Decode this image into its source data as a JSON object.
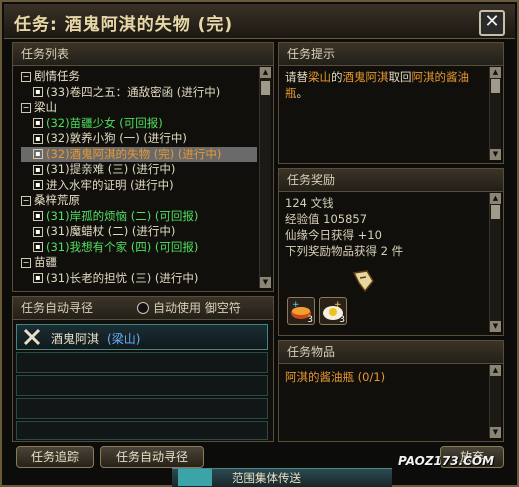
{
  "window": {
    "title": "任务: 酒鬼阿淇的失物 (完)",
    "close_glyph": "✕"
  },
  "quest_list": {
    "header": "任务列表",
    "rows": [
      {
        "label": "剧情任务",
        "type": "cat",
        "box": "−"
      },
      {
        "label": "(33)卷四之五：通敌密函 (进行中)",
        "type": "quest",
        "color": "white",
        "box": "▪"
      },
      {
        "label": "梁山",
        "type": "cat",
        "box": "−"
      },
      {
        "label": "(32)苗疆少女 (可回报)",
        "type": "quest",
        "color": "green",
        "box": "▪"
      },
      {
        "label": "(32)敦养小狗 (一) (进行中)",
        "type": "quest",
        "color": "white",
        "box": "▪"
      },
      {
        "label": "(32)酒鬼阿淇的失物 (完) (进行中)",
        "type": "quest",
        "color": "orange",
        "box": "▪",
        "selected": true
      },
      {
        "label": "(31)提亲难 (三) (进行中)",
        "type": "quest",
        "color": "white",
        "box": "▪"
      },
      {
        "label": "进入水牢的证明 (进行中)",
        "type": "quest",
        "color": "white",
        "box": "▪"
      },
      {
        "label": "桑梓荒原",
        "type": "cat",
        "box": "−"
      },
      {
        "label": "(31)岸孤的烦恼 (二) (可回报)",
        "type": "quest",
        "color": "green",
        "box": "▪"
      },
      {
        "label": "(31)魔蜡杖 (二) (进行中)",
        "type": "quest",
        "color": "white",
        "box": "▪"
      },
      {
        "label": "(31)我想有个家 (四) (可回报)",
        "type": "quest",
        "color": "green",
        "box": "▪"
      },
      {
        "label": "苗疆",
        "type": "cat",
        "box": "−"
      },
      {
        "label": "(31)长老的担忧 (三) (进行中)",
        "type": "quest",
        "color": "white",
        "box": "▪"
      }
    ]
  },
  "hint": {
    "header": "任务提示",
    "parts": [
      {
        "text": "请替",
        "c": "n"
      },
      {
        "text": "梁山",
        "c": "o"
      },
      {
        "text": "的",
        "c": "n"
      },
      {
        "text": "酒鬼阿淇",
        "c": "o"
      },
      {
        "text": "取回",
        "c": "n"
      },
      {
        "text": "阿淇的酱油瓶",
        "c": "o"
      },
      {
        "text": "。",
        "c": "n"
      }
    ]
  },
  "reward": {
    "header": "任务奖励",
    "money": "124 文钱",
    "exp": "经验值 105857",
    "xianyuan": "仙缘今日获得 +10",
    "items_note": "下列奖励物品获得 2 件",
    "icons": [
      {
        "name": "food-bowl-icon",
        "count": "3"
      },
      {
        "name": "fried-egg-icon",
        "count": "3"
      }
    ]
  },
  "items": {
    "header": "任务物品",
    "line": "阿淇的酱油瓶 (0/1)"
  },
  "auto_path": {
    "header": "任务自动寻径",
    "checkbox_label": "自动使用 御空符",
    "target_name": "酒鬼阿淇",
    "target_place": "梁山"
  },
  "buttons": {
    "track": "任务追踪",
    "auto_find": "任务自动寻径",
    "give_up": "放弃"
  },
  "bottom": {
    "teleport": "范围集体传送"
  },
  "watermark": {
    "text": "PAOZ173.COM"
  },
  "colors": {
    "green": "#50e060",
    "orange": "#e89830",
    "white": "#e0d8c0"
  }
}
